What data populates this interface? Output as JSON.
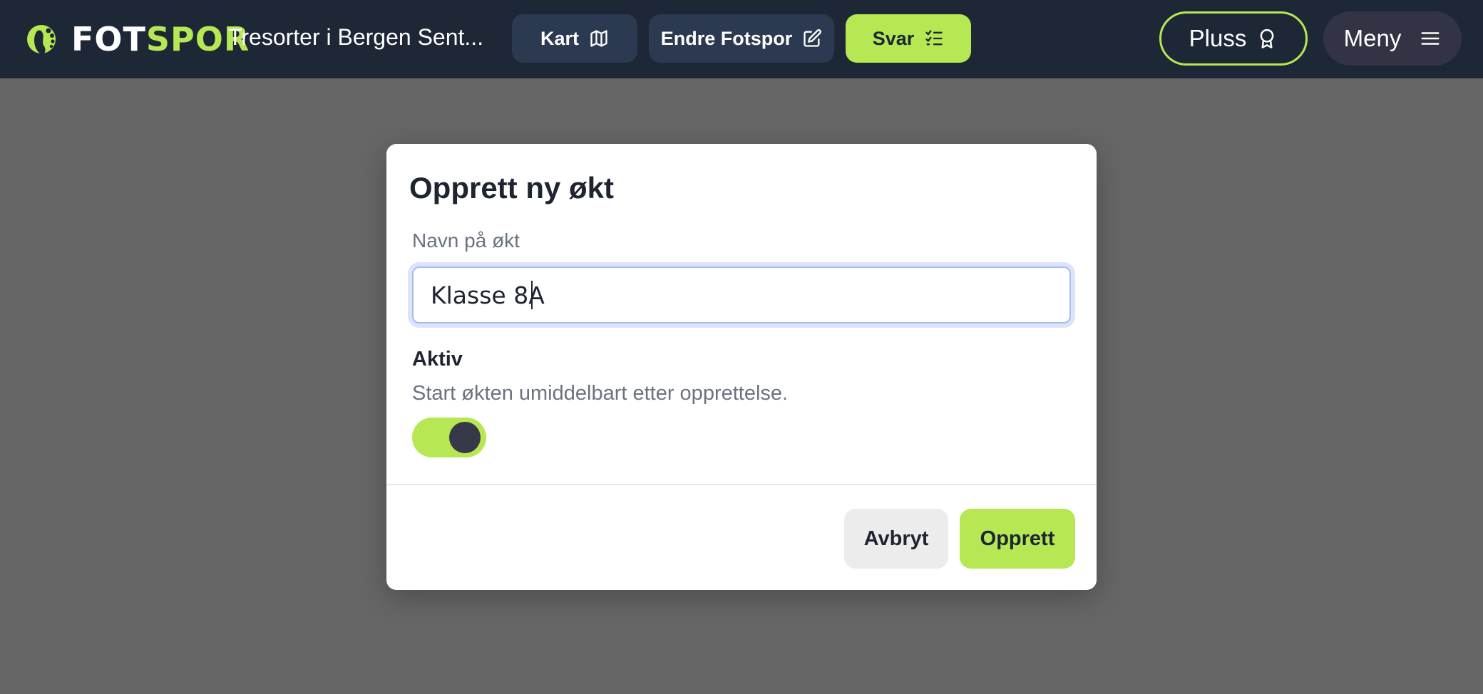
{
  "header": {
    "logo": {
      "part1": "FOT",
      "part2": "SPOR"
    },
    "title": "Tresorter i Bergen Sent...",
    "nav": {
      "kart": "Kart",
      "endre": "Endre Fotspor",
      "svar": "Svar"
    },
    "pluss": "Pluss",
    "meny": "Meny"
  },
  "modal": {
    "title": "Opprett ny økt",
    "name_label": "Navn på økt",
    "name_value": "Klasse 8A",
    "aktiv_label": "Aktiv",
    "aktiv_description": "Start økten umiddelbart etter opprettelse.",
    "aktiv_on": true,
    "cancel": "Avbryt",
    "create": "Opprett"
  },
  "colors": {
    "header_bg": "#1d2736",
    "accent": "#b5e853",
    "backdrop": "#666666",
    "nav_button": "#2b3a50"
  },
  "icons": {
    "logo": "footprint-icon",
    "kart": "map-icon",
    "endre": "edit-icon",
    "svar": "checklist-icon",
    "pluss": "award-icon",
    "meny": "menu-icon"
  }
}
